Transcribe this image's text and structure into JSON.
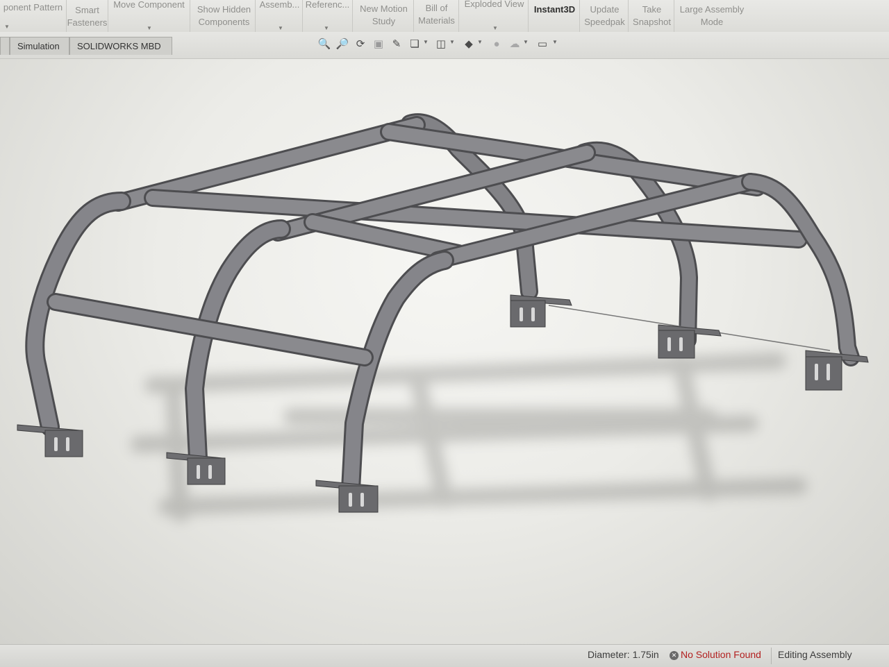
{
  "ribbon": {
    "buttons": [
      {
        "id": "component-pattern",
        "l1": "ponent Pattern",
        "l2": ""
      },
      {
        "id": "smart-fasteners",
        "l1": "Smart",
        "l2": "Fasteners"
      },
      {
        "id": "move-component",
        "l1": "Move Component",
        "l2": ""
      },
      {
        "id": "show-hidden-components",
        "l1": "Show Hidden",
        "l2": "Components"
      },
      {
        "id": "assembly-features",
        "l1": "Assemb...",
        "l2": ""
      },
      {
        "id": "reference-geometry",
        "l1": "Referenc...",
        "l2": ""
      },
      {
        "id": "new-motion-study",
        "l1": "New Motion",
        "l2": "Study"
      },
      {
        "id": "bill-of-materials",
        "l1": "Bill of",
        "l2": "Materials"
      },
      {
        "id": "exploded-view",
        "l1": "Exploded View",
        "l2": ""
      },
      {
        "id": "instant3d",
        "l1": "Instant3D",
        "l2": ""
      },
      {
        "id": "update-speedpak",
        "l1": "Update",
        "l2": "Speedpak"
      },
      {
        "id": "take-snapshot",
        "l1": "Take",
        "l2": "Snapshot"
      },
      {
        "id": "large-assembly-mode",
        "l1": "Large Assembly",
        "l2": "Mode"
      }
    ]
  },
  "tabs": [
    {
      "id": "simulation",
      "label": "Simulation"
    },
    {
      "id": "solidworks-mbd",
      "label": "SOLIDWORKS MBD"
    }
  ],
  "view_toolbar": {
    "icons": [
      "zoom-to-fit-icon",
      "zoom-to-area-icon",
      "previous-view-icon",
      "section-view-icon",
      "dynamic-annotation-icon",
      "view-orientation-icon",
      "display-style-icon",
      "hide-show-items-icon",
      "edit-appearance-icon",
      "apply-scene-icon",
      "view-settings-icon"
    ]
  },
  "status": {
    "diameter": "Diameter: 1.75in",
    "solution": "No Solution Found",
    "mode": "Editing Assembly",
    "error_color": "#b22020"
  },
  "colors": {
    "tube": "#7c7c80",
    "viewport_center": "#f4f4f1"
  }
}
